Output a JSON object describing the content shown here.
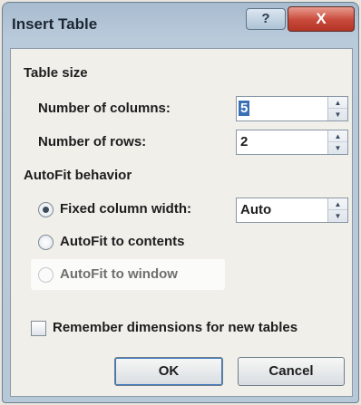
{
  "window": {
    "title": "Insert Table",
    "help_label": "?",
    "close_label": "X"
  },
  "table_size": {
    "section_label": "Table size",
    "columns_label": "Number of columns:",
    "columns_value": "5",
    "rows_label": "Number of rows:",
    "rows_value": "2"
  },
  "autofit": {
    "section_label": "AutoFit behavior",
    "fixed_label": "Fixed column width:",
    "fixed_value": "Auto",
    "contents_label": "AutoFit to contents",
    "window_label": "AutoFit to window",
    "selected": "fixed"
  },
  "remember": {
    "label": "Remember dimensions for new tables",
    "checked": false
  },
  "buttons": {
    "ok": "OK",
    "cancel": "Cancel"
  }
}
